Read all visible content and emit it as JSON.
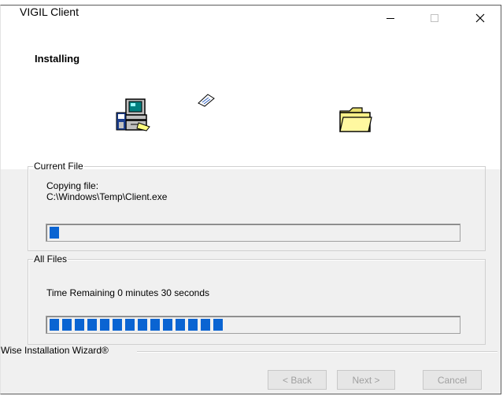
{
  "window": {
    "title": "VIGIL Client"
  },
  "header": {
    "title": "Installing"
  },
  "current_file": {
    "legend": "Current File",
    "copy_label": "Copying file:",
    "path": "C:\\Windows\\Temp\\Client.exe",
    "progress_percent": 3
  },
  "all_files": {
    "legend": "All Files",
    "time_remaining": "Time Remaining 0 minutes 30 seconds",
    "progress_percent": 44
  },
  "footer": {
    "wizard_label": "Wise Installation Wizard®",
    "back_label": "< Back",
    "next_label": "Next >",
    "cancel_label": "Cancel"
  },
  "colors": {
    "progress": "#0a64d2",
    "dialog_bg": "#f0f0f0"
  },
  "icons": [
    "computer-disk-icon",
    "flying-paper-icon",
    "folder-icon",
    "minimize-icon",
    "maximize-icon",
    "close-icon"
  ]
}
